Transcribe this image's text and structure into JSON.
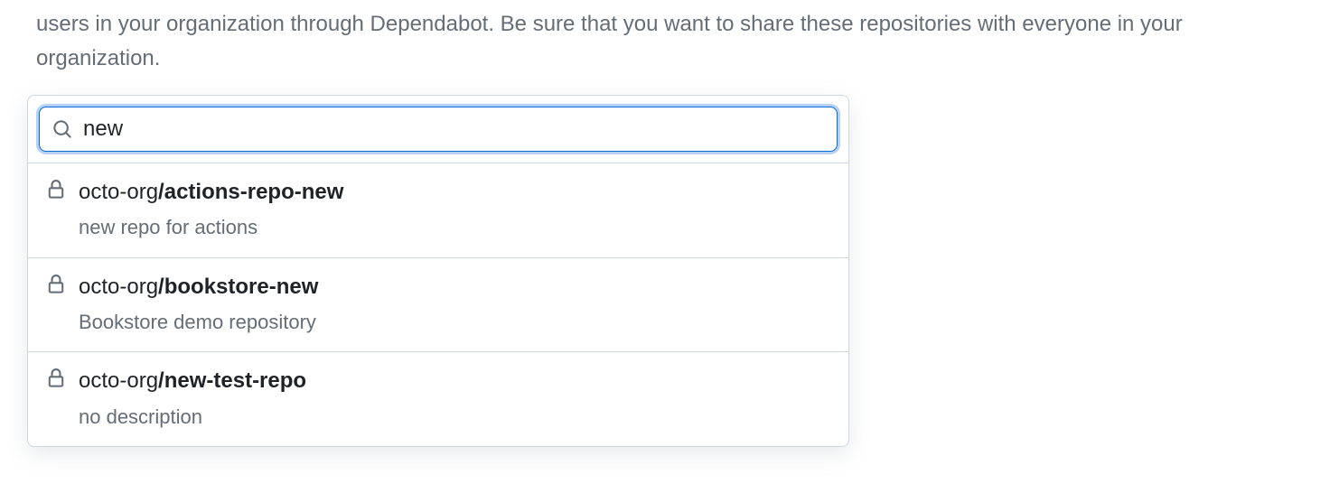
{
  "description": "users in your organization through Dependabot. Be sure that you want to share these repositories with everyone in your organization.",
  "search": {
    "value": "new"
  },
  "results": [
    {
      "org": "octo-org",
      "repo": "actions-repo-new",
      "description": "new repo for actions"
    },
    {
      "org": "octo-org",
      "repo": "bookstore-new",
      "description": "Bookstore demo repository"
    },
    {
      "org": "octo-org",
      "repo": "new-test-repo",
      "description": "no description"
    }
  ]
}
